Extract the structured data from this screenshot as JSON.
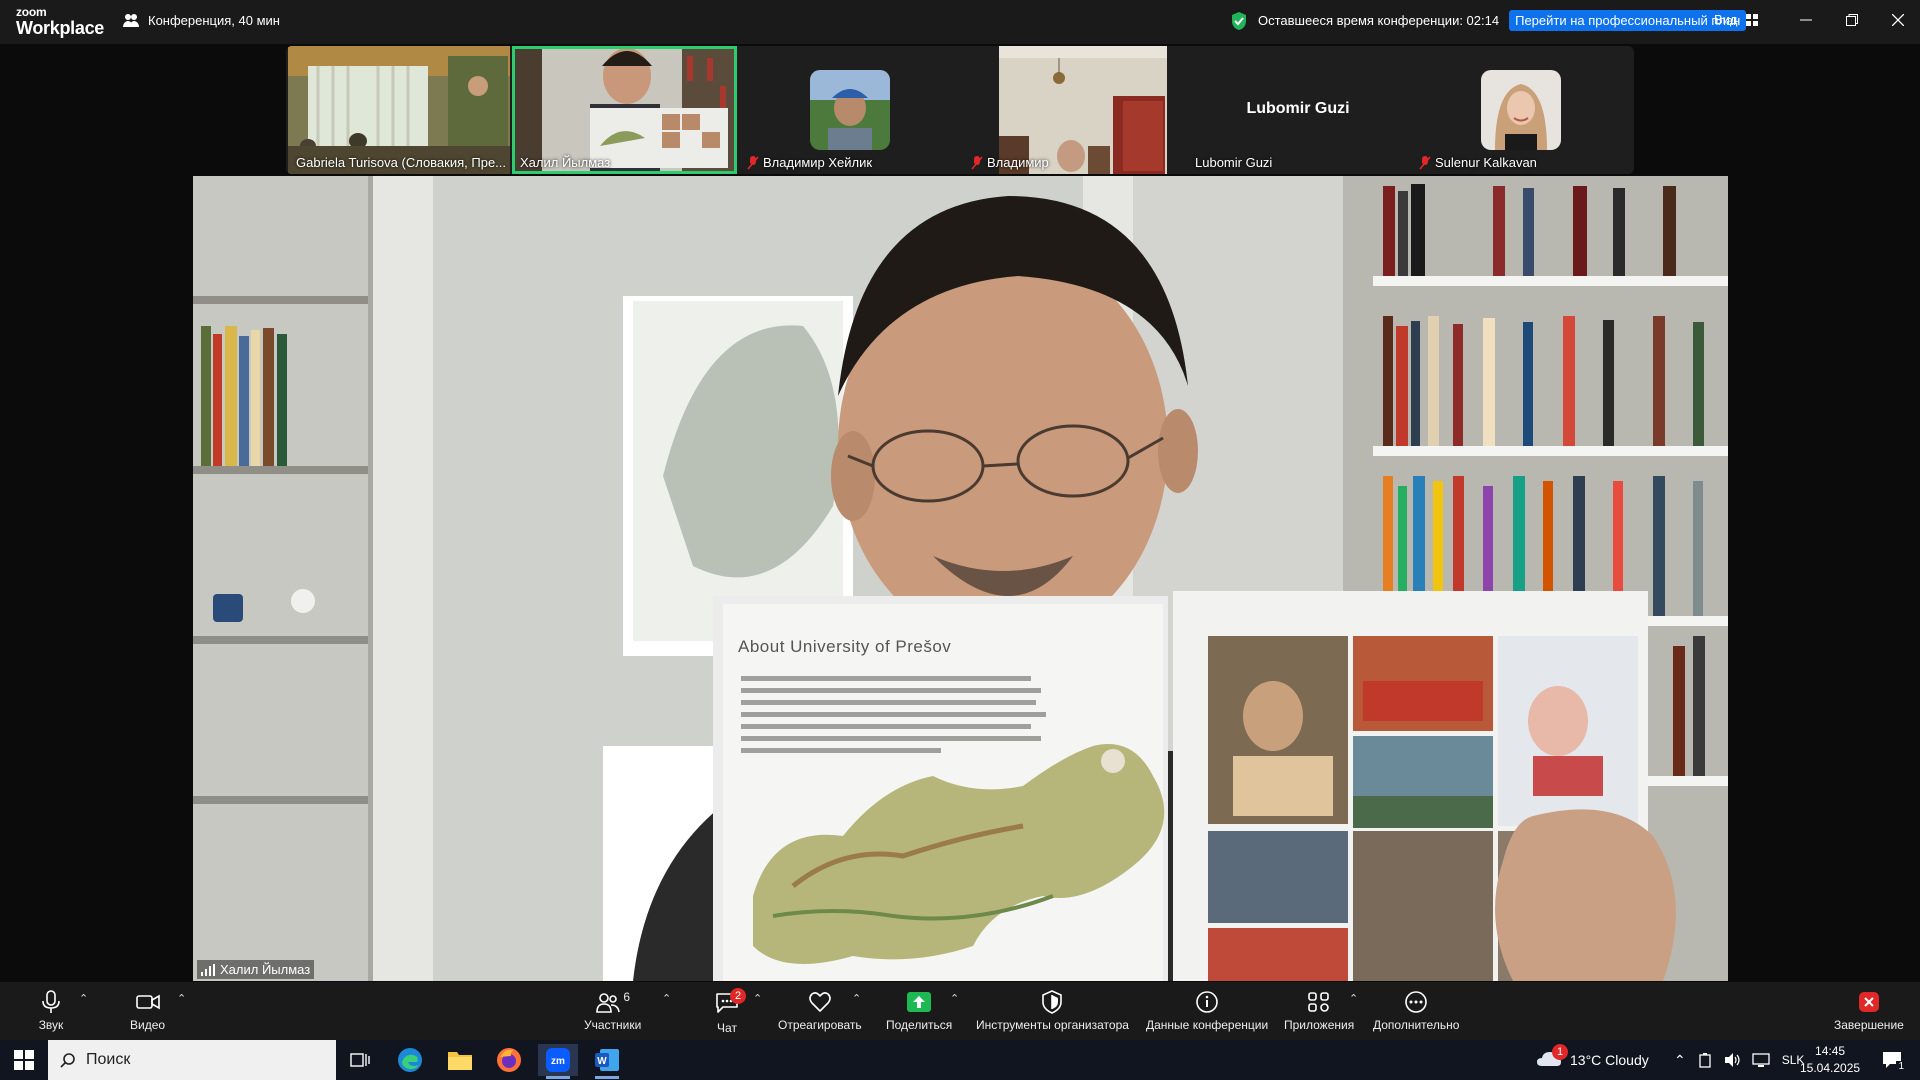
{
  "app": {
    "logo_line1": "zoom",
    "logo_line2": "Workplace",
    "meeting_title": "Конференция, 40 мин"
  },
  "header": {
    "time_remaining": "Оставшееся время конференции: 02:14",
    "upgrade_label": "Перейти на профессиональный план",
    "view_label": "Вид"
  },
  "participants": [
    {
      "name": "Gabriela Turisova (Словакия, Пре...",
      "muted": false,
      "active": false
    },
    {
      "name": "Халил Йылмаз",
      "muted": false,
      "active": true
    },
    {
      "name": "Владимир Хейлик",
      "muted": true,
      "active": false
    },
    {
      "name": "Владимир",
      "muted": true,
      "active": false
    },
    {
      "name": "Lubomir Guzi",
      "muted": false,
      "active": false,
      "no_video_label": "Lubomir Guzi"
    },
    {
      "name": "Sulenur Kalkavan",
      "muted": true,
      "active": false
    }
  ],
  "main_video": {
    "speaker_name": "Халил Йылмаз",
    "book_title": "About University of Prešov"
  },
  "toolbar": {
    "audio": "Звук",
    "video": "Видео",
    "participants": "Участники",
    "participants_count": "6",
    "chat": "Чат",
    "chat_badge": "2",
    "react": "Отреагировать",
    "share": "Поделиться",
    "host_tools": "Инструменты организатора",
    "meeting_info": "Данные конференции",
    "apps": "Приложения",
    "more": "Дополнительно",
    "end": "Завершение"
  },
  "taskbar": {
    "search_placeholder": "Поиск",
    "weather": "13°C  Cloudy",
    "weather_badge": "1",
    "language": "SLK",
    "time": "14:45",
    "date": "15.04.2025",
    "notification_count": "1"
  },
  "colors": {
    "accent_blue": "#0e72ed",
    "active_green": "#2ecc71",
    "end_red": "#e02828",
    "share_green": "#1db954"
  }
}
